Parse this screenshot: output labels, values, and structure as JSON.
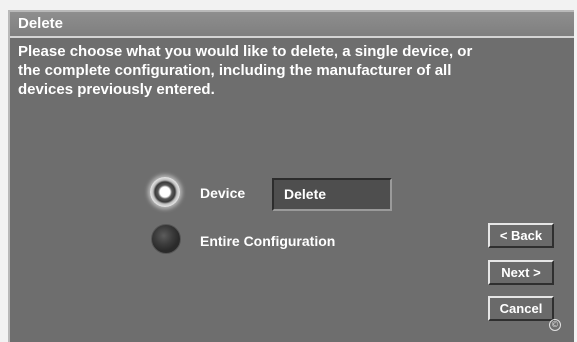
{
  "window": {
    "title": "Delete"
  },
  "prompt": {
    "line1": "Please choose what you would like to delete, a single device, or",
    "line2": "the complete configuration, including the manufacturer of all",
    "line3": "devices previously entered."
  },
  "options": {
    "device": {
      "label": "Device",
      "selected": true
    },
    "entire": {
      "label": "Entire Configuration",
      "selected": false
    }
  },
  "device_field": {
    "value": "Delete"
  },
  "buttons": {
    "back": "< Back",
    "next": "Next >",
    "cancel": "Cancel"
  },
  "footer": {
    "copyright_icon": "copyright-icon",
    "copyright_glyph": "©"
  },
  "colors": {
    "panel": "#6e6e6e",
    "titlebar": "#8a8a8a",
    "text": "#ffffff"
  }
}
